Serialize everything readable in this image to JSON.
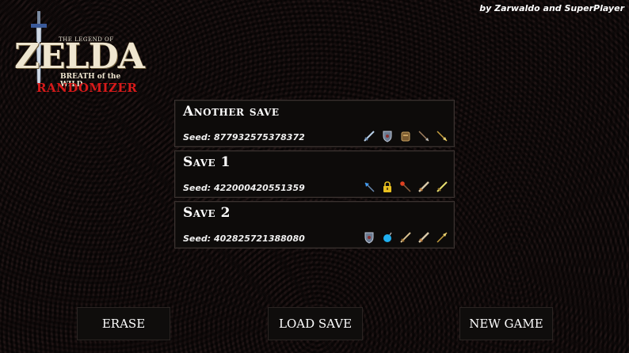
{
  "credit": "by Zarwaldo and SuperPlayer",
  "logo": {
    "legend": "THE LEGEND OF",
    "title": "ZELDA",
    "subtitle": "BREATH of the WILD",
    "edition": "RANDOMIZER"
  },
  "saves": [
    {
      "name": "Another save",
      "seed": "Seed: 877932575378372",
      "items": [
        "sword-icon",
        "shield-icon",
        "armor-icon",
        "arrow-icon",
        "spear-icon"
      ]
    },
    {
      "name": "Save 1",
      "seed": "Seed: 422000420551359",
      "items": [
        "ice-arrow-icon",
        "lock-icon",
        "fire-arrow-icon",
        "claymore-icon",
        "blade-icon"
      ]
    },
    {
      "name": "Save 2",
      "seed": "Seed: 402825721388080",
      "items": [
        "shield-icon",
        "bomb-icon",
        "sword-icon",
        "claymore-icon",
        "spear-icon"
      ]
    }
  ],
  "buttons": {
    "erase": "ERASE",
    "load": "LOAD SAVE",
    "new_game": "NEW GAME"
  },
  "colors": {
    "background": "#2a1a1a",
    "panel": "#0d0b0a",
    "text": "#ffffff",
    "logo_red": "#d81a1a"
  }
}
